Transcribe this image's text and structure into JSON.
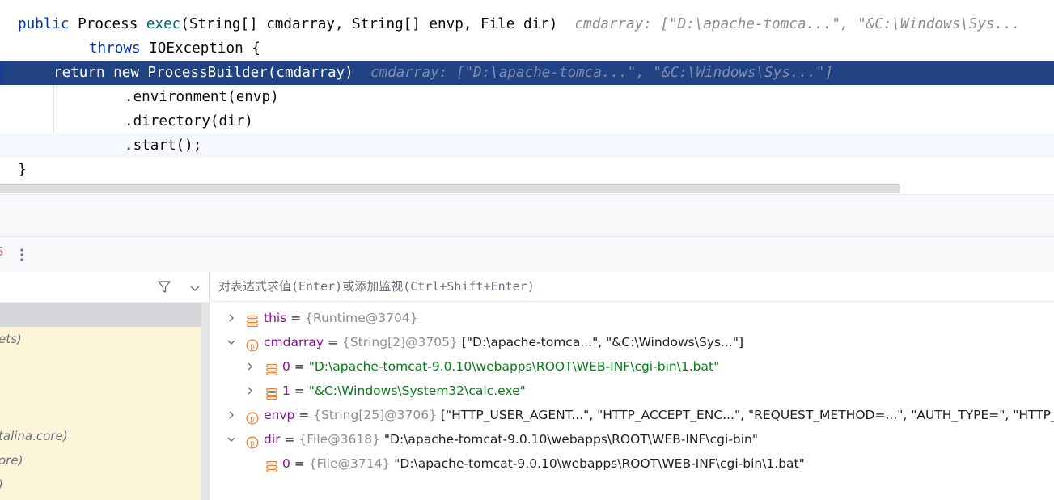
{
  "editor": {
    "line1": {
      "kw_public": "public",
      "type_process": "Process",
      "method_exec": "exec",
      "params": "(String[] cmdarray, String[] envp, File dir)",
      "hint": "cmdarray: [\"D:\\apache-tomca...\", \"&C:\\Windows\\Sys..."
    },
    "line2": {
      "kw_throws": "throws",
      "exception": "IOException {"
    },
    "line3": {
      "kw_return": "return",
      "kw_new": "new",
      "code": "ProcessBuilder(cmdarray)",
      "hint": "cmdarray: [\"D:\\apache-tomca...\", \"&C:\\Windows\\Sys...\"]"
    },
    "line4": ".environment(envp)",
    "line5": ".directory(dir)",
    "line6": ".start();",
    "line7": "}"
  },
  "toolbar": {
    "more_icon": "more-vertical-icon",
    "red_fragment": "5"
  },
  "frames_panel": {
    "filter_icon": "filter-icon",
    "chevron_icon": "chevron-down-icon",
    "frames": [
      "",
      "ets)",
      "",
      "",
      "",
      "talina.core)",
      "ore)",
      ")"
    ]
  },
  "variables": {
    "eval_placeholder": "对表达式求值(Enter)或添加监视(Ctrl+Shift+Enter)",
    "rows": [
      {
        "name": "this",
        "eq": " = ",
        "type": "{Runtime@3704}",
        "value": ""
      },
      {
        "name": "cmdarray",
        "eq": " = ",
        "type": "{String[2]@3705}",
        "value": " [\"D:\\apache-tomca...\", \"&C:\\Windows\\Sys...\"]"
      },
      {
        "name": "0",
        "eq": " = ",
        "type": "",
        "value": "\"D:\\apache-tomcat-9.0.10\\webapps\\ROOT\\WEB-INF\\cgi-bin\\1.bat\""
      },
      {
        "name": "1",
        "eq": " = ",
        "type": "",
        "value": "\"&C:\\Windows\\System32\\calc.exe\""
      },
      {
        "name": "envp",
        "eq": " = ",
        "type": "{String[25]@3706}",
        "value": " [\"HTTP_USER_AGENT...\", \"HTTP_ACCEPT_ENC...\", \"REQUEST_METHOD=...\", \"AUTH_TYPE=\", \"HTTP_"
      },
      {
        "name": "dir",
        "eq": " = ",
        "type": "{File@3618}",
        "value": " \"D:\\apache-tomcat-9.0.10\\webapps\\ROOT\\WEB-INF\\cgi-bin\""
      },
      {
        "name": "0",
        "eq": " = ",
        "type": "{File@3714}",
        "value": " \"D:\\apache-tomcat-9.0.10\\webapps\\ROOT\\WEB-INF\\cgi-bin\\1.bat\""
      }
    ]
  },
  "colors": {
    "selection": "#214283",
    "keyword": "#0033b3",
    "method": "#00627a",
    "hint": "#8c8c8c",
    "var_name": "#871094",
    "string": "#067d17",
    "icon_orange": "#e8833a",
    "frames_bg": "#fdf5d9"
  }
}
